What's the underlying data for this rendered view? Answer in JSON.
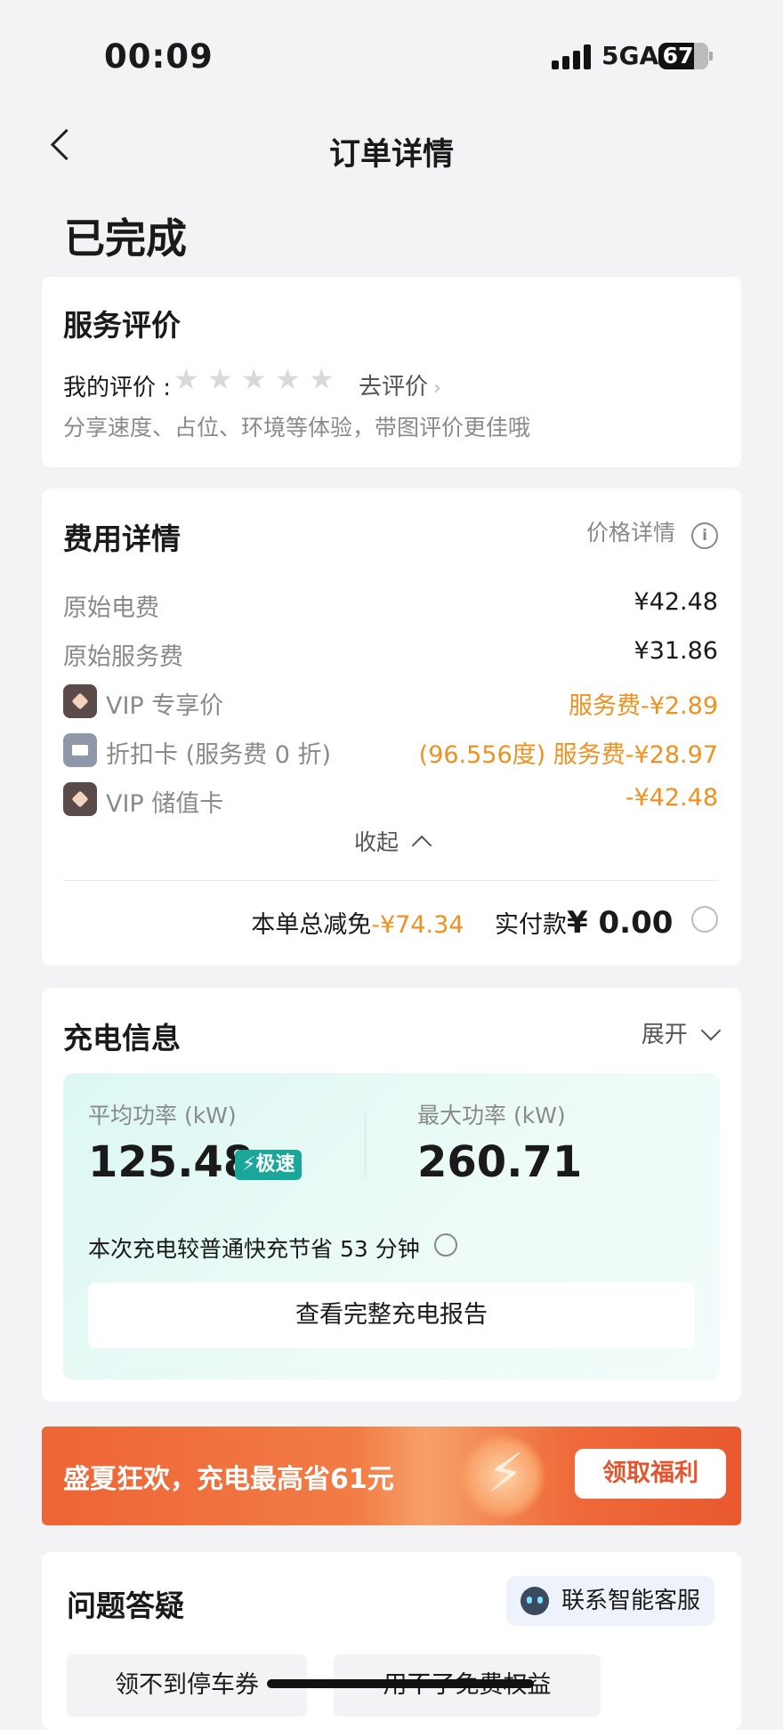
{
  "status_bar": {
    "time": "00:09",
    "network": "5GA",
    "battery": "67"
  },
  "nav": {
    "title": "订单详情"
  },
  "order_status": "已完成",
  "review": {
    "title": "服务评价",
    "label": "我的评价 :",
    "action": "去评价",
    "hint": "分享速度、占位、环境等体验，带图评价更佳哦"
  },
  "fees": {
    "title": "费用详情",
    "price_detail": "价格详情",
    "rows": [
      {
        "label": "原始电费",
        "value": "¥42.48"
      },
      {
        "label": "原始服务费",
        "value": "¥31.86"
      },
      {
        "label": "VIP 专享价",
        "value": "服务费-¥2.89",
        "icon": "vip-diamond-icon"
      },
      {
        "label": "折扣卡 (服务费 0 折)",
        "value": "(96.556度) 服务费-¥28.97",
        "icon": "discount-card-icon"
      },
      {
        "label": "VIP 储值卡",
        "value": "-¥42.48",
        "icon": "vip-diamond-icon"
      }
    ],
    "collapse": "收起",
    "total_discount_label": "本单总减免",
    "total_discount_value": "-¥74.34",
    "paid_label": "实付款",
    "paid_value": "¥ 0.00"
  },
  "charging": {
    "title": "充电信息",
    "expand": "展开",
    "avg_label": "平均功率 (kW)",
    "avg_value": "125.48",
    "speed_badge": "极速",
    "max_label": "最大功率 (kW)",
    "max_value": "260.71",
    "saving_text": "本次充电较普通快充节省 53 分钟",
    "report_button": "查看完整充电报告"
  },
  "banner": {
    "text": "盛夏狂欢，充电最高省61元",
    "button": "领取福利"
  },
  "faq": {
    "title": "问题答疑",
    "contact": "联系智能客服",
    "chips": [
      "领不到停车券",
      "用不了免费权益"
    ]
  },
  "colors": {
    "accent_orange": "#f0901e",
    "banner_start": "#f06a3a",
    "teal": "#1aa79a"
  }
}
